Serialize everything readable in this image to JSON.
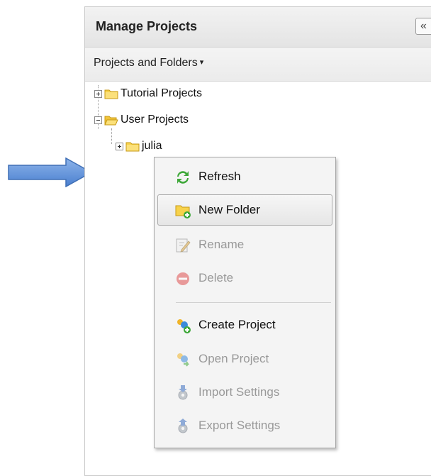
{
  "panel": {
    "title": "Manage Projects",
    "collapse_icon": "double-chevron-left-icon",
    "collapse_symbol": "«",
    "toolbar_menu": "Projects and Folders",
    "toolbar_caret": "▾"
  },
  "tree": {
    "nodes": [
      {
        "label": "Tutorial Projects",
        "expanded": false
      },
      {
        "label": "User Projects",
        "expanded": true
      },
      {
        "label": "julia",
        "expanded": false
      }
    ]
  },
  "context_menu": {
    "items": [
      {
        "label": "Refresh",
        "icon": "refresh-icon",
        "enabled": true
      },
      {
        "label": "New Folder",
        "icon": "new-folder-icon",
        "enabled": true,
        "hovered": true
      },
      {
        "label": "Rename",
        "icon": "rename-icon",
        "enabled": false
      },
      {
        "label": "Delete",
        "icon": "delete-icon",
        "enabled": false
      },
      {
        "label": "Create Project",
        "icon": "create-project-icon",
        "enabled": true
      },
      {
        "label": "Open Project",
        "icon": "open-project-icon",
        "enabled": false
      },
      {
        "label": "Import Settings",
        "icon": "import-settings-icon",
        "enabled": false
      },
      {
        "label": "Export Settings",
        "icon": "export-settings-icon",
        "enabled": false
      }
    ]
  },
  "colors": {
    "folder": "#f7d24b",
    "arrow": "#5b8fd6",
    "disabled_text": "#999999"
  }
}
